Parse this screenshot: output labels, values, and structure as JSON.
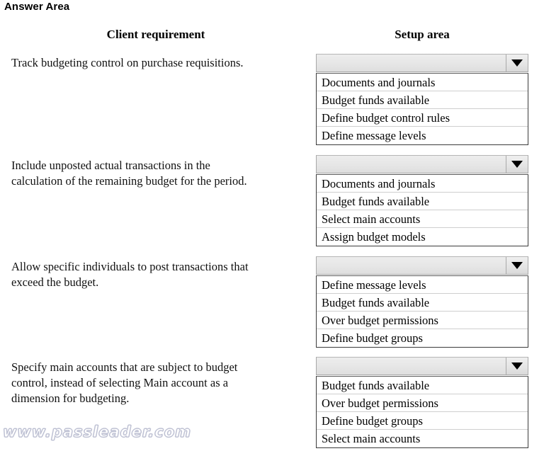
{
  "page": {
    "title": "Answer Area",
    "watermark": "www.passleader.com"
  },
  "columns": {
    "left_header": "Client requirement",
    "right_header": "Setup area"
  },
  "rows": [
    {
      "requirement_lines": [
        "Track budgeting control on purchase requisitions."
      ],
      "dropdown": {
        "selected": "",
        "arrow_icon": "chevron-down-icon",
        "options": [
          "Documents and journals",
          "Budget funds available",
          "Define budget control rules",
          "Define message levels"
        ]
      }
    },
    {
      "requirement_lines": [
        "Include unposted actual transactions in the",
        "calculation of the remaining budget for the period."
      ],
      "dropdown": {
        "selected": "",
        "arrow_icon": "chevron-down-icon",
        "options": [
          "Documents and journals",
          "Budget funds available",
          "Select main accounts",
          "Assign budget models"
        ]
      }
    },
    {
      "requirement_lines": [
        "Allow specific individuals to post transactions that",
        "exceed the budget."
      ],
      "dropdown": {
        "selected": "",
        "arrow_icon": "chevron-down-icon",
        "options": [
          "Define message levels",
          "Budget funds available",
          "Over budget permissions",
          "Define budget groups"
        ]
      }
    },
    {
      "requirement_lines": [
        "Specify main accounts that are subject to budget",
        "control, instead of selecting Main account as a",
        "dimension for budgeting."
      ],
      "dropdown": {
        "selected": "",
        "arrow_icon": "chevron-down-icon",
        "options": [
          "Budget funds available",
          "Over budget permissions",
          "Define budget groups",
          "Select main accounts"
        ]
      }
    }
  ],
  "layout": {
    "requirement_tops": [
      78,
      223,
      366,
      508
    ],
    "dropdown_tops": [
      76,
      219,
      362,
      504
    ]
  },
  "colors": {
    "page_background": "#ffffff",
    "combobox_fill": "#e6e6e6",
    "combobox_border": "#a8a8a8",
    "list_border": "#3b3b3b",
    "row_separator": "#cfcfcf",
    "text": "#000000",
    "watermark": "#c3c6d6"
  }
}
